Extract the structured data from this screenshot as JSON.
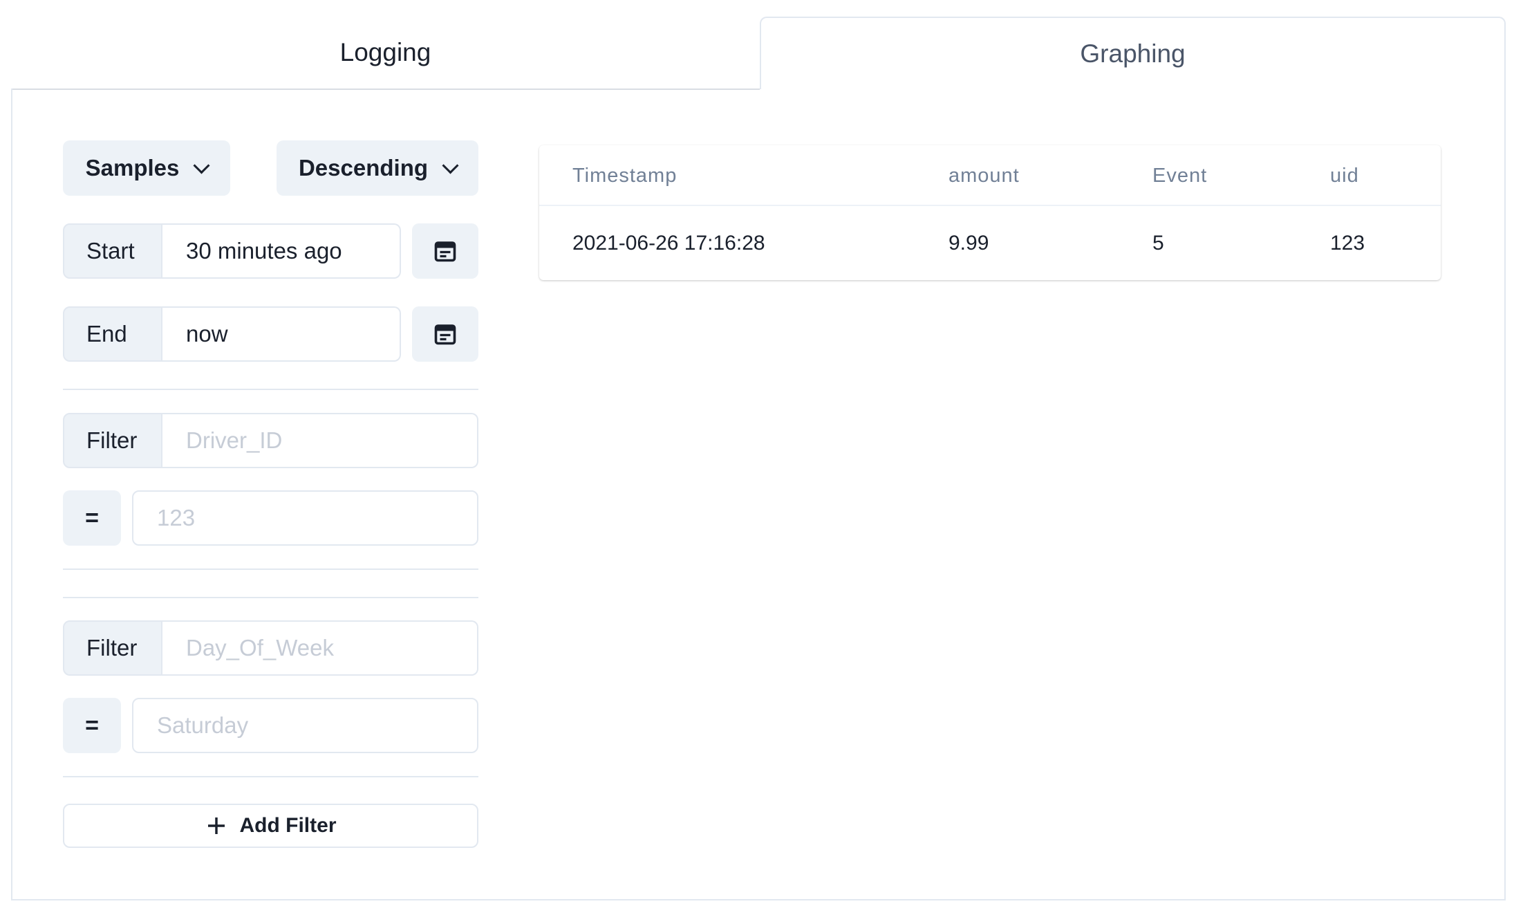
{
  "tabs": [
    {
      "label": "Logging"
    },
    {
      "label": "Graphing"
    }
  ],
  "controls": {
    "mode_select": "Samples",
    "order_select": "Descending",
    "start": {
      "label": "Start",
      "value": "30 minutes ago"
    },
    "end": {
      "label": "End",
      "value": "now"
    }
  },
  "filters": [
    {
      "label": "Filter",
      "field_placeholder": "Driver_ID",
      "operator": "=",
      "value_placeholder": "123"
    },
    {
      "label": "Filter",
      "field_placeholder": "Day_Of_Week",
      "operator": "=",
      "value_placeholder": "Saturday"
    }
  ],
  "add_filter_label": "Add Filter",
  "table": {
    "columns": [
      "Timestamp",
      "amount",
      "Event",
      "uid"
    ],
    "rows": [
      [
        "2021-06-26 17:16:28",
        "9.99",
        "5",
        "123"
      ]
    ]
  },
  "icons": {
    "calendar": "calendar-icon",
    "plus": "plus-icon",
    "chevron": "chevron-down-icon"
  }
}
